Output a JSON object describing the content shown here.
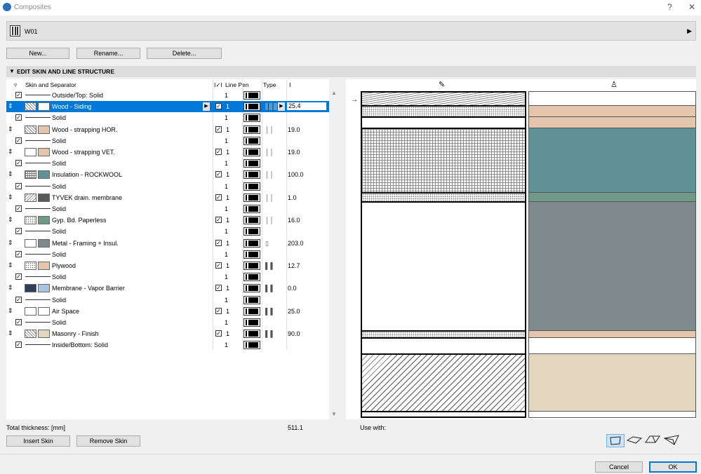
{
  "window": {
    "title": "Composites",
    "help": "?",
    "close": "✕"
  },
  "composite": {
    "name": "W01"
  },
  "buttons": {
    "new": "New...",
    "rename": "Rename...",
    "delete": "Delete...",
    "insert_skin": "Insert Skin",
    "remove_skin": "Remove Skin",
    "cancel": "Cancel",
    "ok": "OK"
  },
  "section": {
    "title": "EDIT SKIN AND LINE STRUCTURE"
  },
  "table": {
    "col_skin": "Skin and Separator",
    "col_vis": "I✓I",
    "col_linepen": "Line Pen",
    "col_type": "Type",
    "col_thickness_icon": "thickness-icon"
  },
  "rows": [
    {
      "kind": "sep",
      "label": "Outside/Top: Solid",
      "pen": "1",
      "checked": true
    },
    {
      "kind": "skin",
      "label": "Wood - Siding",
      "pen": "1",
      "thickness": "25.4",
      "selected": true,
      "hatch": "hatch-a",
      "fill": "#ffffff",
      "type": "││"
    },
    {
      "kind": "sep",
      "label": "Solid",
      "pen": "1",
      "checked": true
    },
    {
      "kind": "skin",
      "label": "Wood - strapping HOR.",
      "pen": "1",
      "thickness": "19.0",
      "hatch": "hatch-a",
      "fill": "#e3c6ab",
      "type": "││"
    },
    {
      "kind": "sep",
      "label": "Solid",
      "pen": "1",
      "checked": true
    },
    {
      "kind": "skin",
      "label": "Wood - strapping VET.",
      "pen": "1",
      "thickness": "19.0",
      "hatch": "none",
      "fill": "#e3c6ab",
      "type": "││"
    },
    {
      "kind": "sep",
      "label": "Solid",
      "pen": "1",
      "checked": true
    },
    {
      "kind": "skin",
      "label": "Insulation - ROCKWOOL",
      "pen": "1",
      "thickness": "100.0",
      "hatch": "hatch-b",
      "fill": "#5f9196",
      "type": "││"
    },
    {
      "kind": "sep",
      "label": "Solid",
      "pen": "1",
      "checked": true
    },
    {
      "kind": "skin",
      "label": "TYVEK drain. membrane",
      "pen": "1",
      "thickness": "1.0",
      "hatch": "hatch-c",
      "fill": "#5a5a5a",
      "type": "││"
    },
    {
      "kind": "sep",
      "label": "Solid",
      "pen": "1",
      "checked": true
    },
    {
      "kind": "skin",
      "label": "Gyp. Bd. Paperless",
      "pen": "1",
      "thickness": "16.0",
      "hatch": "dots",
      "fill": "#6f9a8a",
      "type": "││"
    },
    {
      "kind": "sep",
      "label": "Solid",
      "pen": "1",
      "checked": true
    },
    {
      "kind": "skin",
      "label": "Metal - Framing + Insul.",
      "pen": "1",
      "thickness": "203.0",
      "hatch": "none",
      "fill": "#7f8a8c",
      "type": "▯"
    },
    {
      "kind": "sep",
      "label": "Solid",
      "pen": "1",
      "checked": true
    },
    {
      "kind": "skin",
      "label": "Plywood",
      "pen": "1",
      "thickness": "12.7",
      "hatch": "dots",
      "fill": "#e3c6ab",
      "type": "▌▌"
    },
    {
      "kind": "sep",
      "label": "Solid",
      "pen": "1",
      "checked": true
    },
    {
      "kind": "skin",
      "label": "Membrane - Vapor Barrier",
      "pen": "1",
      "thickness": "0.0",
      "hatch": "dark",
      "fill": "#a9c3e0",
      "type": "▌▌"
    },
    {
      "kind": "sep",
      "label": "Solid",
      "pen": "1",
      "checked": true
    },
    {
      "kind": "skin",
      "label": "Air Space",
      "pen": "1",
      "thickness": "25.0",
      "hatch": "none",
      "fill": "#ffffff",
      "type": "▌▌"
    },
    {
      "kind": "sep",
      "label": "Solid",
      "pen": "1",
      "checked": true
    },
    {
      "kind": "skin",
      "label": "Masonry - Finish",
      "pen": "1",
      "thickness": "90.0",
      "hatch": "hatch-a",
      "fill": "#e3d6be",
      "type": "▌▌"
    },
    {
      "kind": "sep",
      "label": "Inside/Bottom: Solid",
      "pen": "1",
      "checked": true
    }
  ],
  "totals": {
    "label": "Total thickness: [mm]",
    "value": "511.1"
  },
  "preview": {
    "use_with_label": "Use with:",
    "left_header_icon": "fill-hatch-icon",
    "right_header_icon": "paint-bucket-icon",
    "layers": [
      {
        "h": 20,
        "hatch": "wave",
        "fill": "#ffffff"
      },
      {
        "h": 16,
        "hatch": "dots",
        "fill": "#e3c6ab"
      },
      {
        "h": 16,
        "hatch": "none",
        "fill": "#e3c6ab"
      },
      {
        "h": 92,
        "hatch": "grid",
        "fill": "#5f9196"
      },
      {
        "h": 13,
        "hatch": "dots",
        "fill": "#6f9a8a"
      },
      {
        "h": 184,
        "hatch": "none",
        "fill": "#7f8a8c"
      },
      {
        "h": 10,
        "hatch": "dots",
        "fill": "#e3c6ab"
      },
      {
        "h": 23,
        "hatch": "none",
        "fill": "#ffffff"
      },
      {
        "h": 82,
        "hatch": "diag",
        "fill": "#e3d6be"
      }
    ]
  },
  "use_with_icons": [
    "wall-icon",
    "slab-icon",
    "roof-icon",
    "shell-icon"
  ],
  "colors": {
    "accent": "#0078d7",
    "selection": "#0078d7"
  }
}
